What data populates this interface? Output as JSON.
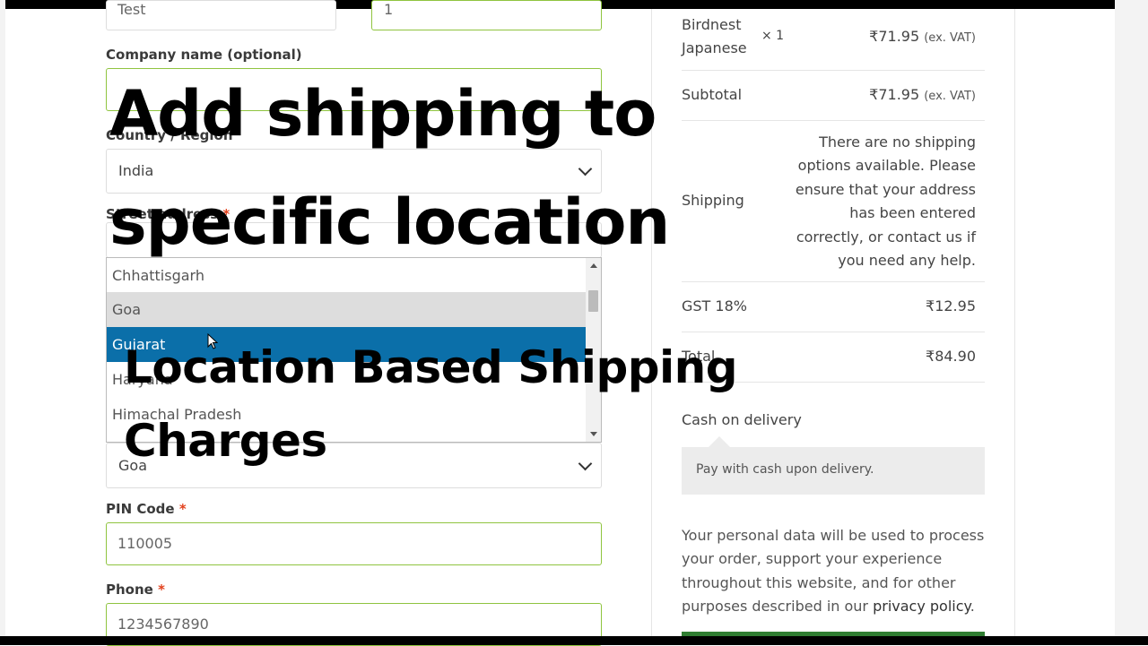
{
  "form": {
    "first_name_value": "Test",
    "last_name_value": "1",
    "company_label": "Company name (optional)",
    "country_label": "Country / Region",
    "country_value": "India",
    "street_label": "Street address",
    "dropdown_items": [
      "Chhattisgarh",
      "Goa",
      "Gujarat",
      "Haryana",
      "Himachal Pradesh"
    ],
    "state_value": "Goa",
    "pin_label": "PIN Code",
    "pin_value": "110005",
    "phone_label": "Phone",
    "phone_value": "1234567890",
    "required_mark": "*"
  },
  "order": {
    "product_name_line1": "Birdnest",
    "product_name_line2": "Japanese",
    "product_qty": "× 1",
    "product_price": "₹71.95",
    "ex_vat": "(ex. VAT)",
    "subtotal_label": "Subtotal",
    "subtotal_value": "₹71.95",
    "shipping_label": "Shipping",
    "shipping_message": "There are no shipping options available. Please ensure that your address has been entered correctly, or contact us if you need any help.",
    "gst_label": "GST 18%",
    "gst_value": "₹12.95",
    "total_label": "Total",
    "total_value": "₹84.90"
  },
  "payment": {
    "method_label": "Cash on delivery",
    "method_description": "Pay with cash upon delivery."
  },
  "privacy": {
    "text": "Your personal data will be used to process your order, support your experience throughout this website, and for other purposes described in our ",
    "link": "privacy policy",
    "end": "."
  },
  "overlay": {
    "line1": "Add shipping to",
    "line2": "specific location",
    "line3": "Location Based Shipping",
    "line4": "Charges"
  },
  "colors": {
    "accent_green_border": "#8fc43f",
    "selected_item": "#0b6fa9",
    "required": "#e2401c",
    "button_green": "#2f7d31"
  }
}
